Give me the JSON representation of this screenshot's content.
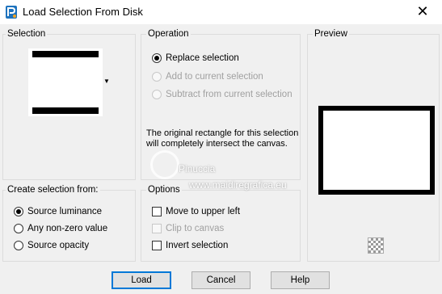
{
  "window": {
    "title": "Load Selection From Disk",
    "close_glyph": "✕",
    "app_icon": "psp-icon"
  },
  "selection": {
    "legend": "Selection"
  },
  "operation": {
    "legend": "Operation",
    "options": [
      {
        "label": "Replace selection",
        "selected": true,
        "enabled": true
      },
      {
        "label": "Add to current selection",
        "selected": false,
        "enabled": false
      },
      {
        "label": "Subtract from current selection",
        "selected": false,
        "enabled": false
      }
    ],
    "info": "The original rectangle for this selection will completely intersect the canvas."
  },
  "preview": {
    "legend": "Preview"
  },
  "create_from": {
    "legend": "Create selection from:",
    "options": [
      {
        "label": "Source luminance",
        "selected": true
      },
      {
        "label": "Any non-zero value",
        "selected": false
      },
      {
        "label": "Source opacity",
        "selected": false
      }
    ]
  },
  "options": {
    "legend": "Options",
    "items": [
      {
        "label": "Move to upper left",
        "checked": false,
        "enabled": true
      },
      {
        "label": "Clip to canvas",
        "checked": false,
        "enabled": false
      },
      {
        "label": "Invert selection",
        "checked": false,
        "enabled": true
      }
    ]
  },
  "watermark": {
    "name": "Pinuccia",
    "url": "www.maidiregrafica.eu"
  },
  "buttons": {
    "load": "Load",
    "cancel": "Cancel",
    "help": "Help"
  }
}
